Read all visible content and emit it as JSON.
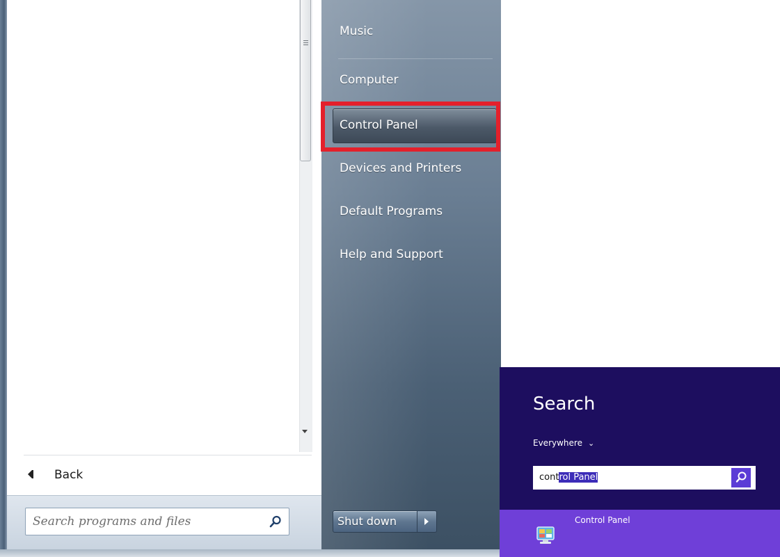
{
  "win7_start_menu": {
    "right_items": [
      {
        "label": "Music"
      },
      {
        "label": "Computer"
      },
      {
        "label": "Control Panel"
      },
      {
        "label": "Devices and Printers"
      },
      {
        "label": "Default Programs"
      },
      {
        "label": "Help and Support"
      }
    ],
    "back_label": "Back",
    "search_placeholder": "Search programs and files",
    "shutdown_label": "Shut down",
    "highlight_color": "#e4202b"
  },
  "win8_search": {
    "title": "Search",
    "scope": "Everywhere",
    "query_typed": "cont",
    "query_autocomplete": "rol Panel",
    "result_label": "Control Panel",
    "background_color": "#1d0e5f",
    "result_color": "#6f3fd8"
  }
}
